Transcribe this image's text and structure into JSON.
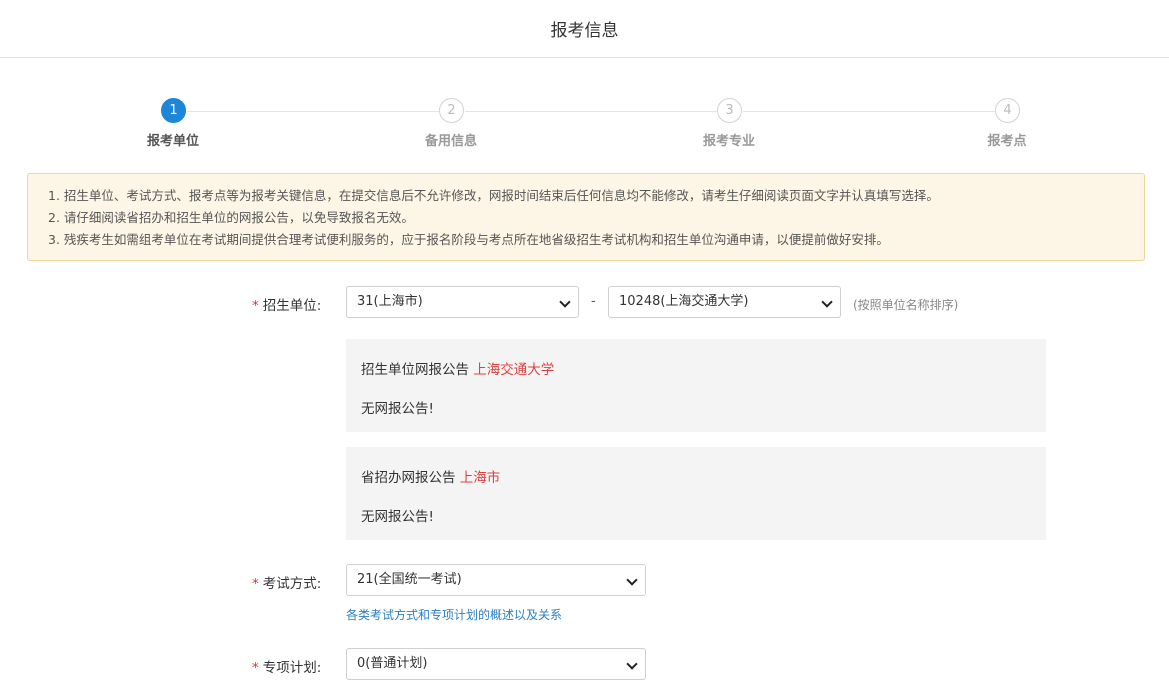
{
  "header": {
    "title": "报考信息"
  },
  "steps": [
    {
      "number": "1",
      "label": "报考单位",
      "state": "active"
    },
    {
      "number": "2",
      "label": "备用信息",
      "state": "inactive"
    },
    {
      "number": "3",
      "label": "报考专业",
      "state": "inactive"
    },
    {
      "number": "4",
      "label": "报考点",
      "state": "inactive"
    }
  ],
  "notice": {
    "lines": [
      "1. 招生单位、考试方式、报考点等为报考关键信息，在提交信息后不允许修改，网报时间结束后任何信息均不能修改，请考生仔细阅读页面文字并认真填写选择。",
      "2. 请仔细阅读省招办和招生单位的网报公告，以免导致报名无效。",
      "3. 残疾考生如需组考单位在考试期间提供合理考试便利服务的，应于报名阶段与考点所在地省级招生考试机构和招生单位沟通申请，以便提前做好安排。"
    ]
  },
  "form": {
    "required_mark": "*",
    "unit": {
      "label": "招生单位:",
      "province_value": "31(上海市)",
      "separator": "-",
      "school_value": "10248(上海交通大学)",
      "hint": "(按照单位名称排序)"
    },
    "school_notice": {
      "title": "招生单位网报公告",
      "link": "上海交通大学",
      "body": "无网报公告!"
    },
    "province_notice": {
      "title": "省招办网报公告",
      "link": "上海市",
      "body": "无网报公告!"
    },
    "exam_mode": {
      "label": "考试方式:",
      "value": "21(全国统一考试)",
      "link": "各类考试方式和专项计划的概述以及关系"
    },
    "special_plan": {
      "label": "专项计划:",
      "value": "0(普通计划)"
    }
  },
  "colors": {
    "accent": "#1d86d8",
    "required": "#e03030",
    "notice_bg": "#fdf6e6",
    "notice_border": "#f2d797",
    "panel_bg": "#f4f4f4",
    "link_red": "#e04040",
    "link_blue": "#2b7fc2"
  }
}
